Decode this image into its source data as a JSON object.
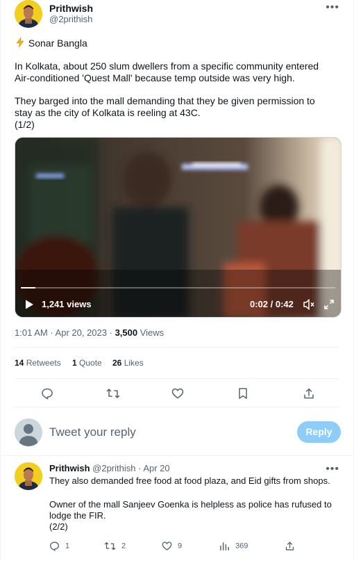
{
  "tweet": {
    "author_name": "Prithwish",
    "author_handle": "@2prithish",
    "more_label": "•••",
    "line_title": "Sonar Bangla",
    "para1_line1": "In Kolkata, about 250 slum dwellers from a specific community entered",
    "para1_line2": "Air-conditioned 'Quest Mall' because temp outside was very high.",
    "para2_line1": "They barged into the mall demanding that they be given permission to",
    "para2_line2": "stay as the city of Kolkata is reeling at 43C.",
    "para2_line3": "(1/2)",
    "icons": {
      "title_icon": "lightning-emoji-icon"
    }
  },
  "video": {
    "views_label": "1,241 views",
    "time_readout": "0:02 / 0:42",
    "progress_fraction": 0.047,
    "icons": {
      "play": "play-icon",
      "mute": "mute-icon",
      "fullscreen": "fullscreen-icon"
    }
  },
  "meta": {
    "time": "1:01 AM",
    "sep1": " · ",
    "date": "Apr 20, 2023",
    "sep2": " · ",
    "views_num": "3,500",
    "views_label": "Views"
  },
  "stats": {
    "retweets_num": "14",
    "retweets_label": "Retweets",
    "quotes_num": "1",
    "quotes_label": "Quote",
    "likes_num": "26",
    "likes_label": "Likes"
  },
  "actions": {
    "icons": [
      "reply-icon",
      "retweet-icon",
      "like-icon",
      "bookmark-icon",
      "share-icon"
    ]
  },
  "composer": {
    "placeholder": "Tweet your reply",
    "reply_button": "Reply"
  },
  "reply": {
    "author_name": "Prithwish",
    "author_handle": "@2prithish",
    "sep": " · ",
    "date": "Apr 20",
    "more_label": "•••",
    "line1": "They also demanded free food at food plaza, and Eid gifts from shops.",
    "line2": "Owner of the mall Sanjeev Goenka is helpless as police has rufused to",
    "line3": "lodge the FIR.",
    "line4": "(2/2)",
    "replies": "1",
    "retweets": "2",
    "likes": "9",
    "views": "369"
  },
  "colors": {
    "accent": "#1d9bf0",
    "reply_button_disabled": "#8ecdf7",
    "secondary_text": "#536471"
  }
}
